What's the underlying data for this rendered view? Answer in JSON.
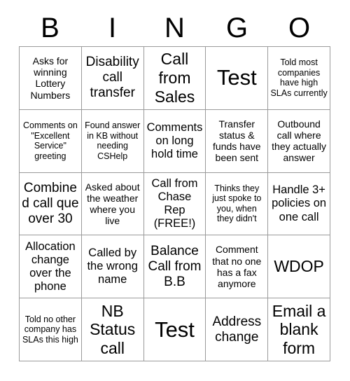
{
  "card": {
    "title": "BINGO",
    "header_letters": [
      "B",
      "I",
      "N",
      "G",
      "O"
    ],
    "grid_size": 5,
    "colors": {
      "background": "#ffffff",
      "text": "#000000",
      "grid_line": "#9a9a9a"
    },
    "cells": [
      {
        "text": "Asks for winning Lottery Numbers",
        "size": "sm",
        "column": "B",
        "row": 1
      },
      {
        "text": "Disability call transfer",
        "size": "lg",
        "column": "I",
        "row": 1
      },
      {
        "text": "Call from Sales",
        "size": "xl",
        "column": "N",
        "row": 1
      },
      {
        "text": "Test",
        "size": "xxl",
        "column": "G",
        "row": 1
      },
      {
        "text": "Told most companies have high SLAs currently",
        "size": "xs",
        "column": "O",
        "row": 1
      },
      {
        "text": "Comments on \"Excellent Service\" greeting",
        "size": "xs",
        "column": "B",
        "row": 2
      },
      {
        "text": "Found answer in KB without needing CSHelp",
        "size": "xs",
        "column": "I",
        "row": 2
      },
      {
        "text": "Comments on long hold time",
        "size": "md",
        "column": "N",
        "row": 2
      },
      {
        "text": "Transfer status & funds have been sent",
        "size": "sm",
        "column": "G",
        "row": 2
      },
      {
        "text": "Outbound call where they actually answer",
        "size": "sm",
        "column": "O",
        "row": 2
      },
      {
        "text": "Combined call que over 30",
        "size": "lg",
        "column": "B",
        "row": 3
      },
      {
        "text": "Asked about the weather where you live",
        "size": "sm",
        "column": "I",
        "row": 3
      },
      {
        "text": "Call from Chase Rep (FREE!)",
        "size": "md",
        "column": "N",
        "row": 3
      },
      {
        "text": "Thinks they just spoke to you, when they didn't",
        "size": "xs",
        "column": "G",
        "row": 3
      },
      {
        "text": "Handle 3+ policies on one call",
        "size": "md",
        "column": "O",
        "row": 3
      },
      {
        "text": "Allocation change over the phone",
        "size": "md",
        "column": "B",
        "row": 4
      },
      {
        "text": "Called by the wrong name",
        "size": "md",
        "column": "I",
        "row": 4
      },
      {
        "text": "Balance Call from B.B",
        "size": "lg",
        "column": "N",
        "row": 4
      },
      {
        "text": "Comment that no one has a fax anymore",
        "size": "sm",
        "column": "G",
        "row": 4
      },
      {
        "text": "WDOP",
        "size": "xl",
        "column": "O",
        "row": 4
      },
      {
        "text": "Told no other company has SLAs this high",
        "size": "xs",
        "column": "B",
        "row": 5
      },
      {
        "text": "NB Status call",
        "size": "xl",
        "column": "I",
        "row": 5
      },
      {
        "text": "Test",
        "size": "xxl",
        "column": "N",
        "row": 5
      },
      {
        "text": "Address change",
        "size": "lg",
        "column": "G",
        "row": 5
      },
      {
        "text": "Email a blank form",
        "size": "xl",
        "column": "O",
        "row": 5
      }
    ]
  }
}
